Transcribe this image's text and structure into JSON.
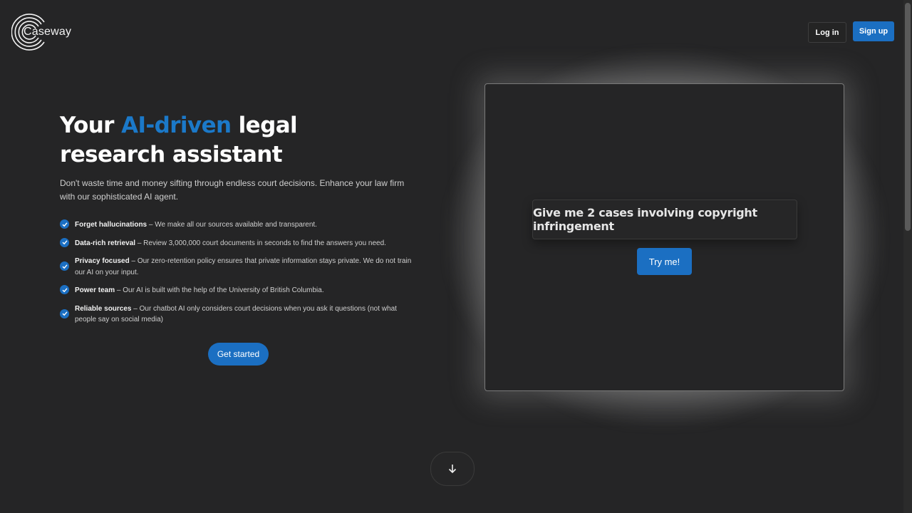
{
  "brand": {
    "name": "Caseway",
    "logo_icon": "concentric-circles-logo"
  },
  "header": {
    "login_label": "Log in",
    "signup_label": "Sign up"
  },
  "hero": {
    "title_before": "Your ",
    "title_accent": "AI-driven",
    "title_after": " legal research assistant",
    "accent_color": "#1b79c9",
    "description": "Don't waste time and money sifting through endless court decisions. Enhance your law firm with our sophisticated AI agent.",
    "features": [
      {
        "title": "Forget hallucinations",
        "text": " – We make all our sources available and transparent."
      },
      {
        "title": "Data-rich retrieval",
        "text": " – Review 3,000,000 court documents in seconds to find the answers you need."
      },
      {
        "title": "Privacy focused",
        "text": " – Our zero-retention policy ensures that private information stays private. We do not train our AI on your input."
      },
      {
        "title": "Power team",
        "text": " – Our AI is built with the help of the University of British Columbia."
      },
      {
        "title": "Reliable sources",
        "text": " – Our chatbot AI only considers court decisions when you ask it questions (not what people say on social media)"
      }
    ],
    "cta_label": "Get started"
  },
  "demo": {
    "prompt": "Give me 2 cases involving copyright infringement",
    "try_label": "Try me!"
  },
  "scroll": {
    "icon": "arrow-down-icon"
  },
  "colors": {
    "background": "#252526",
    "primary": "#1b6fc2"
  }
}
